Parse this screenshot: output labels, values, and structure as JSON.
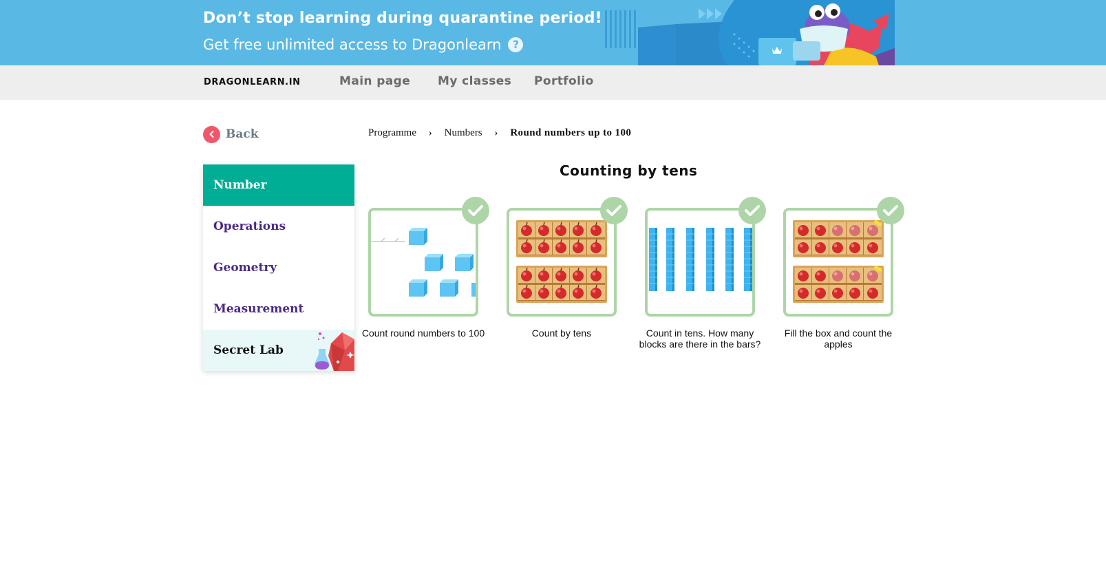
{
  "banner": {
    "headline": "Don’t stop learning during quarantine period!",
    "subline": "Get free unlimited access to Dragonlearn",
    "help_glyph": "?"
  },
  "topnav": {
    "logo": "DRAGONLEARN.IN",
    "links": [
      "Main page",
      "My classes",
      "Portfolio"
    ]
  },
  "back": {
    "label": "Back"
  },
  "breadcrumb": {
    "items": [
      "Programme",
      "Numbers"
    ],
    "current": "Round numbers up to 100",
    "separator": "›"
  },
  "sidebar": {
    "items": [
      "Number",
      "Operations",
      "Geometry",
      "Measurement",
      "Secret Lab"
    ],
    "active": "Number"
  },
  "section": {
    "title": "Counting by tens"
  },
  "cards": [
    {
      "caption": "Count round numbers to 100",
      "completed": true,
      "icon": "cubes-illustration"
    },
    {
      "caption": "Count by tens",
      "completed": true,
      "icon": "apple-tray-illustration"
    },
    {
      "caption": "Count in tens. How many blocks are there in the bars?",
      "completed": true,
      "icon": "block-bars-illustration"
    },
    {
      "caption": "Fill the box and count the apples",
      "completed": true,
      "icon": "apple-tray-illustration"
    }
  ],
  "colors": {
    "banner_bg": "#5ab8e4",
    "accent_green": "#00ae96",
    "check_green": "#aed5a8",
    "back_red": "#f0576a",
    "menu_purple": "#4b2a86"
  }
}
